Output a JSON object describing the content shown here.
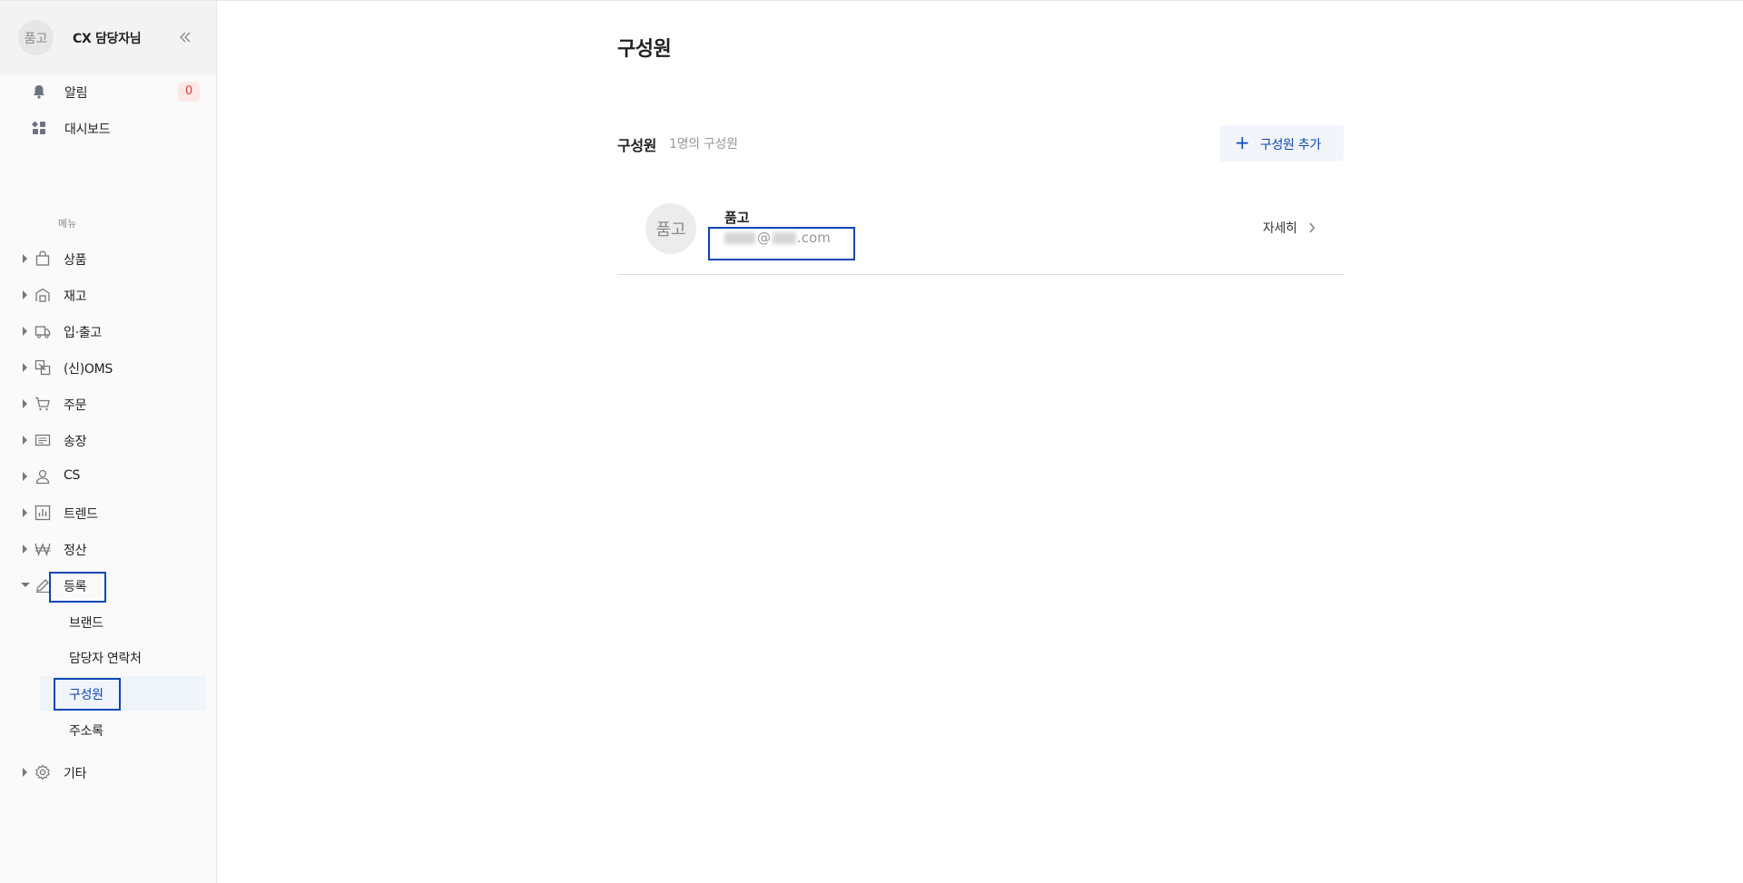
{
  "profile": {
    "avatar_text": "품고",
    "name": "CX 담당자님"
  },
  "top_items": [
    {
      "label": "알림",
      "icon": "bell-icon",
      "badge": "0"
    },
    {
      "label": "대시보드",
      "icon": "dashboard-icon"
    }
  ],
  "menu": {
    "section_label": "메뉴",
    "items": [
      {
        "label": "상품",
        "icon": "bag-icon"
      },
      {
        "label": "재고",
        "icon": "warehouse-icon"
      },
      {
        "label": "입·출고",
        "icon": "truck-icon"
      },
      {
        "label": "(신)OMS",
        "icon": "oms-icon"
      },
      {
        "label": "주문",
        "icon": "cart-icon"
      },
      {
        "label": "송장",
        "icon": "invoice-icon"
      },
      {
        "label": "CS",
        "icon": "person-icon"
      },
      {
        "label": "트렌드",
        "icon": "chart-icon"
      },
      {
        "label": "정산",
        "icon": "won-icon"
      },
      {
        "label": "등록",
        "icon": "pencil-icon",
        "expanded": true
      },
      {
        "label": "기타",
        "icon": "gear-icon"
      }
    ],
    "sub_items": [
      {
        "label": "브랜드"
      },
      {
        "label": "담당자 연락처"
      },
      {
        "label": "구성원",
        "active": true
      },
      {
        "label": "주소록"
      }
    ]
  },
  "main": {
    "title": "구성원",
    "section_title": "구성원",
    "section_count": "1명의 구성원",
    "add_button": "구성원 추가",
    "members": [
      {
        "avatar_text": "품고",
        "name": "품고",
        "email_visible_at": "@",
        "email_visible_domain": ".com",
        "detail_label": "자세히"
      }
    ]
  },
  "colors": {
    "accent": "#0b47b5",
    "badge_bg": "#fde8e8",
    "badge_text": "#e53935",
    "active_bg": "#f0f4fb"
  }
}
